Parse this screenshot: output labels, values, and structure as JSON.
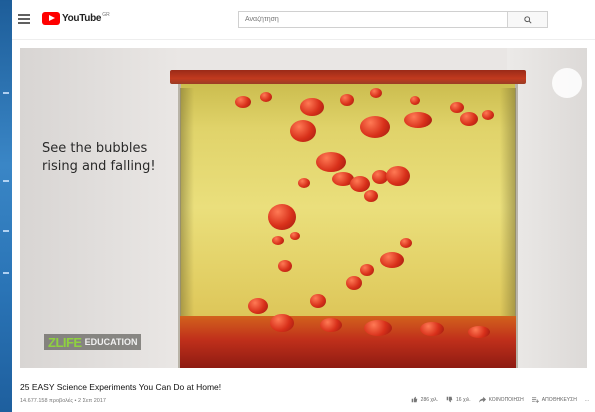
{
  "header": {
    "logo_text": "YouTube",
    "logo_region": "GR",
    "search_placeholder": "Αναζήτηση"
  },
  "video": {
    "caption_line1": "See the bubbles",
    "caption_line2": "rising and falling!",
    "watermark_brand": "ZLIFE",
    "watermark_sub": "EDUCATION"
  },
  "info": {
    "title": "25 EASY Science Experiments You Can Do at Home!",
    "meta": "14.677.158 προβολές • 2 Σεπ 2017"
  },
  "actions": {
    "like": "286 χιλ.",
    "dislike": "16 χιλ.",
    "share": "ΚΟΙΝΟΠΟΙΗΣΗ",
    "save": "ΑΠΟΘΗΚΕΥΣΗ",
    "more": "..."
  },
  "colors": {
    "brand_red": "#ff0000",
    "zlife_green": "#8fd13f",
    "desktop_blue": "#2b6fae"
  },
  "icons": [
    "menu-icon",
    "youtube-logo-icon",
    "search-icon",
    "thumbs-up-icon",
    "thumbs-down-icon",
    "share-icon",
    "save-playlist-icon",
    "more-icon"
  ]
}
